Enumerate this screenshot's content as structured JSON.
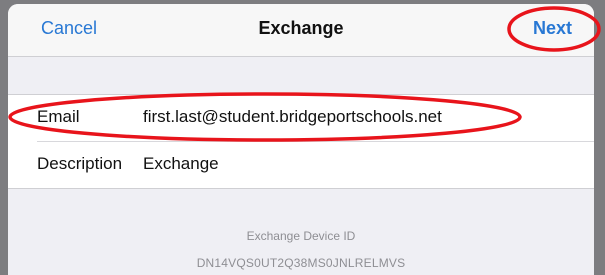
{
  "navbar": {
    "cancel_label": "Cancel",
    "title": "Exchange",
    "next_label": "Next"
  },
  "form": {
    "email_label": "Email",
    "email_value": "first.last@student.bridgeportschools.net",
    "description_label": "Description",
    "description_value": "Exchange"
  },
  "device": {
    "id_title": "Exchange Device ID",
    "id_value": "DN14VQS0UT2Q38MS0JNLRELMVS"
  },
  "colors": {
    "accent": "#2878d4",
    "annotation": "#e8141b"
  }
}
